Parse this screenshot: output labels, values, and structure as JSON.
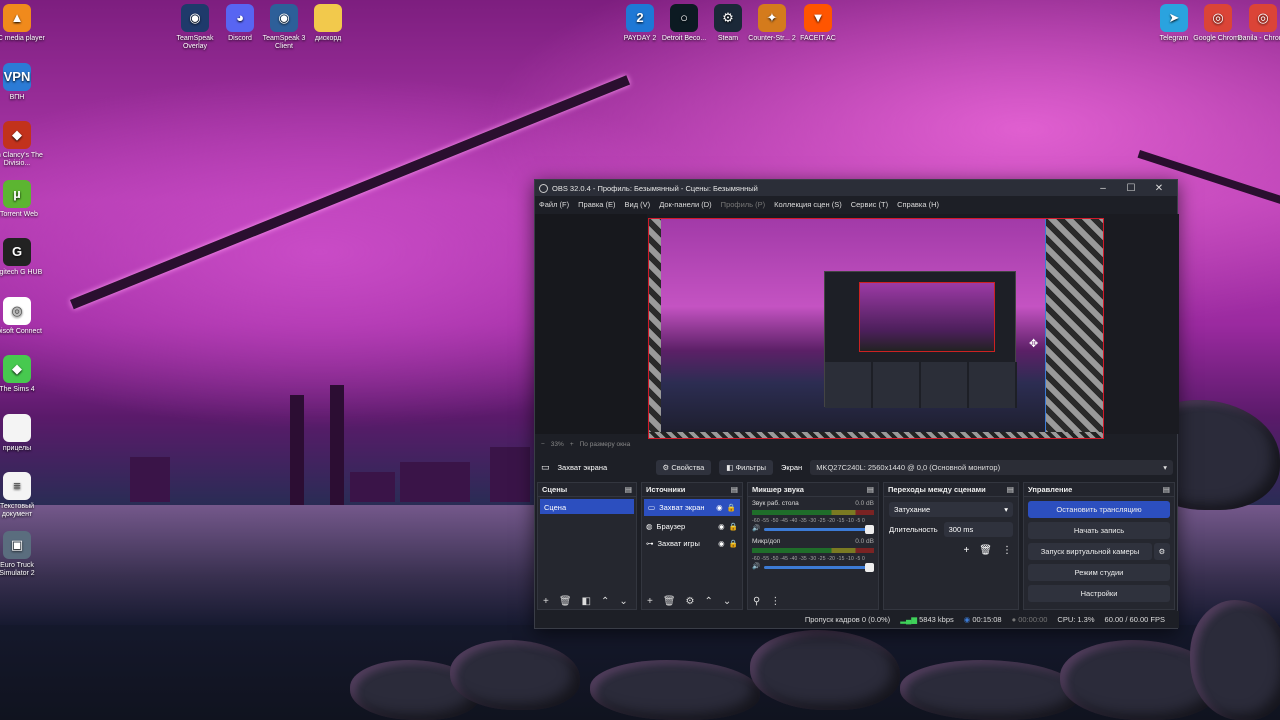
{
  "desktop": {
    "icons_left": [
      {
        "label": "VLC media player",
        "icon": "vlc-cone-icon",
        "color": "#f08a1c",
        "glyph": "▲"
      },
      {
        "label": "ВПН",
        "icon": "vpn-icon",
        "color": "#2b7bd6",
        "glyph": "VPN"
      },
      {
        "label": "om Clancy's The Divisio...",
        "icon": "division-game-icon",
        "color": "#c2321c",
        "glyph": "◆"
      },
      {
        "label": "uTorrent Web",
        "icon": "utorrent-icon",
        "color": "#5cb531",
        "glyph": "µ"
      },
      {
        "label": "Logitech G HUB",
        "icon": "logitech-g-icon",
        "color": "#222222",
        "glyph": "G"
      },
      {
        "label": "Ubisoft Connect",
        "icon": "ubisoft-icon",
        "color": "#ffffff",
        "glyph": "◎"
      },
      {
        "label": "The Sims 4",
        "icon": "sims-plumbob-icon",
        "color": "#47c94f",
        "glyph": "◆"
      },
      {
        "label": "прицелы",
        "icon": "file-icon",
        "color": "#f4f4f4",
        "glyph": ""
      },
      {
        "label": "Текстовый документ",
        "icon": "text-document-icon",
        "color": "#f4f4f4",
        "glyph": "≡"
      },
      {
        "label": "Euro Truck Simulator 2",
        "icon": "ets2-truck-icon",
        "color": "#5a6d7e",
        "glyph": "▣"
      }
    ],
    "icons_top": [
      {
        "label": "TeamSpeak Overlay",
        "icon": "teamspeak-overlay-icon",
        "color": "#1f3a6b",
        "glyph": "◉"
      },
      {
        "label": "Discord",
        "icon": "discord-icon",
        "color": "#5865f2",
        "glyph": "◕"
      },
      {
        "label": "TeamSpeak 3 Client",
        "icon": "teamspeak-icon",
        "color": "#2d5f99",
        "glyph": "◉"
      },
      {
        "label": "дискорд",
        "icon": "folder-icon",
        "color": "#f2c94c",
        "glyph": ""
      },
      {
        "label": "PAYDAY 2",
        "icon": "payday2-icon",
        "color": "#1e78d6",
        "glyph": "2"
      },
      {
        "label": "Detroit Beco...",
        "icon": "detroit-icon",
        "color": "#0c1a22",
        "glyph": "○"
      },
      {
        "label": "Steam",
        "icon": "steam-icon",
        "color": "#1b2838",
        "glyph": "⚙"
      },
      {
        "label": "Counter-Str... 2",
        "icon": "cs2-icon",
        "color": "#d47b1c",
        "glyph": "✦"
      },
      {
        "label": "FACEIT AC",
        "icon": "faceit-icon",
        "color": "#ff5500",
        "glyph": "▼"
      },
      {
        "label": "Telegram",
        "icon": "telegram-icon",
        "color": "#2aa3df",
        "glyph": "➤"
      },
      {
        "label": "Google Chrome",
        "icon": "chrome-icon",
        "color": "#db4437",
        "glyph": "◎"
      },
      {
        "label": "Danila - Chrome",
        "icon": "chrome-profile-icon",
        "color": "#db4437",
        "glyph": "◎"
      }
    ]
  },
  "obs": {
    "title": "OBS 32.0.4 - Профиль: Безымянный - Сцены: Безымянный",
    "window_controls": {
      "minimize": "–",
      "maximize": "☐",
      "close": "✕"
    },
    "menu": [
      {
        "label": "Файл (F)",
        "disabled": false
      },
      {
        "label": "Правка (E)",
        "disabled": false
      },
      {
        "label": "Вид (V)",
        "disabled": false
      },
      {
        "label": "Док-панели (D)",
        "disabled": false
      },
      {
        "label": "Профиль (P)",
        "disabled": true
      },
      {
        "label": "Коллекция сцен (S)",
        "disabled": false
      },
      {
        "label": "Сервис (T)",
        "disabled": false
      },
      {
        "label": "Справка (H)",
        "disabled": false
      }
    ],
    "zoom": {
      "minus": "−",
      "value": "33%",
      "plus": "+",
      "fit": "По размеру окна"
    },
    "source_toolbar": {
      "source_name": "Захват экрана",
      "properties": "Свойства",
      "filters": "Фильтры",
      "display_label": "Экран",
      "display_value": "MKQ27C240L: 2560x1440 @ 0,0 (Основной монитор)"
    },
    "scenes": {
      "title": "Сцены",
      "items": [
        "Сцена"
      ]
    },
    "sources": {
      "title": "Источники",
      "items": [
        {
          "name": "Захват экран",
          "icon": "monitor-icon",
          "selected": true
        },
        {
          "name": "Браузер",
          "icon": "globe-icon",
          "selected": false
        },
        {
          "name": "Захват игры",
          "icon": "gamepad-icon",
          "selected": false
        }
      ]
    },
    "mixer": {
      "title": "Микшер звука",
      "channels": [
        {
          "name": "Звук раб. стола",
          "db": "0.0 dB"
        },
        {
          "name": "Микр/доп",
          "db": "0.0 dB"
        }
      ],
      "scale": "-60 -55 -50 -45 -40 -35 -30 -25 -20 -15 -10 -5 0"
    },
    "transitions": {
      "title": "Переходы между сценами",
      "type": "Затухание",
      "duration_label": "Длительность",
      "duration_value": "300 ms"
    },
    "controls": {
      "title": "Управление",
      "stop_stream": "Остановить трансляцию",
      "start_record": "Начать запись",
      "virtual_cam": "Запуск виртуальной камеры",
      "studio_mode": "Режим студии",
      "settings": "Настройки"
    },
    "status": {
      "dropped": "Пропуск кадров 0 (0.0%)",
      "bitrate": "5843 kbps",
      "stream_time": "00:15:08",
      "record_time": "00:00:00",
      "cpu": "CPU: 1.3%",
      "fps": "60.00 / 60.00 FPS"
    },
    "colors": {
      "accent": "#2c4fbf",
      "selection_border": "#d21a2a"
    }
  }
}
